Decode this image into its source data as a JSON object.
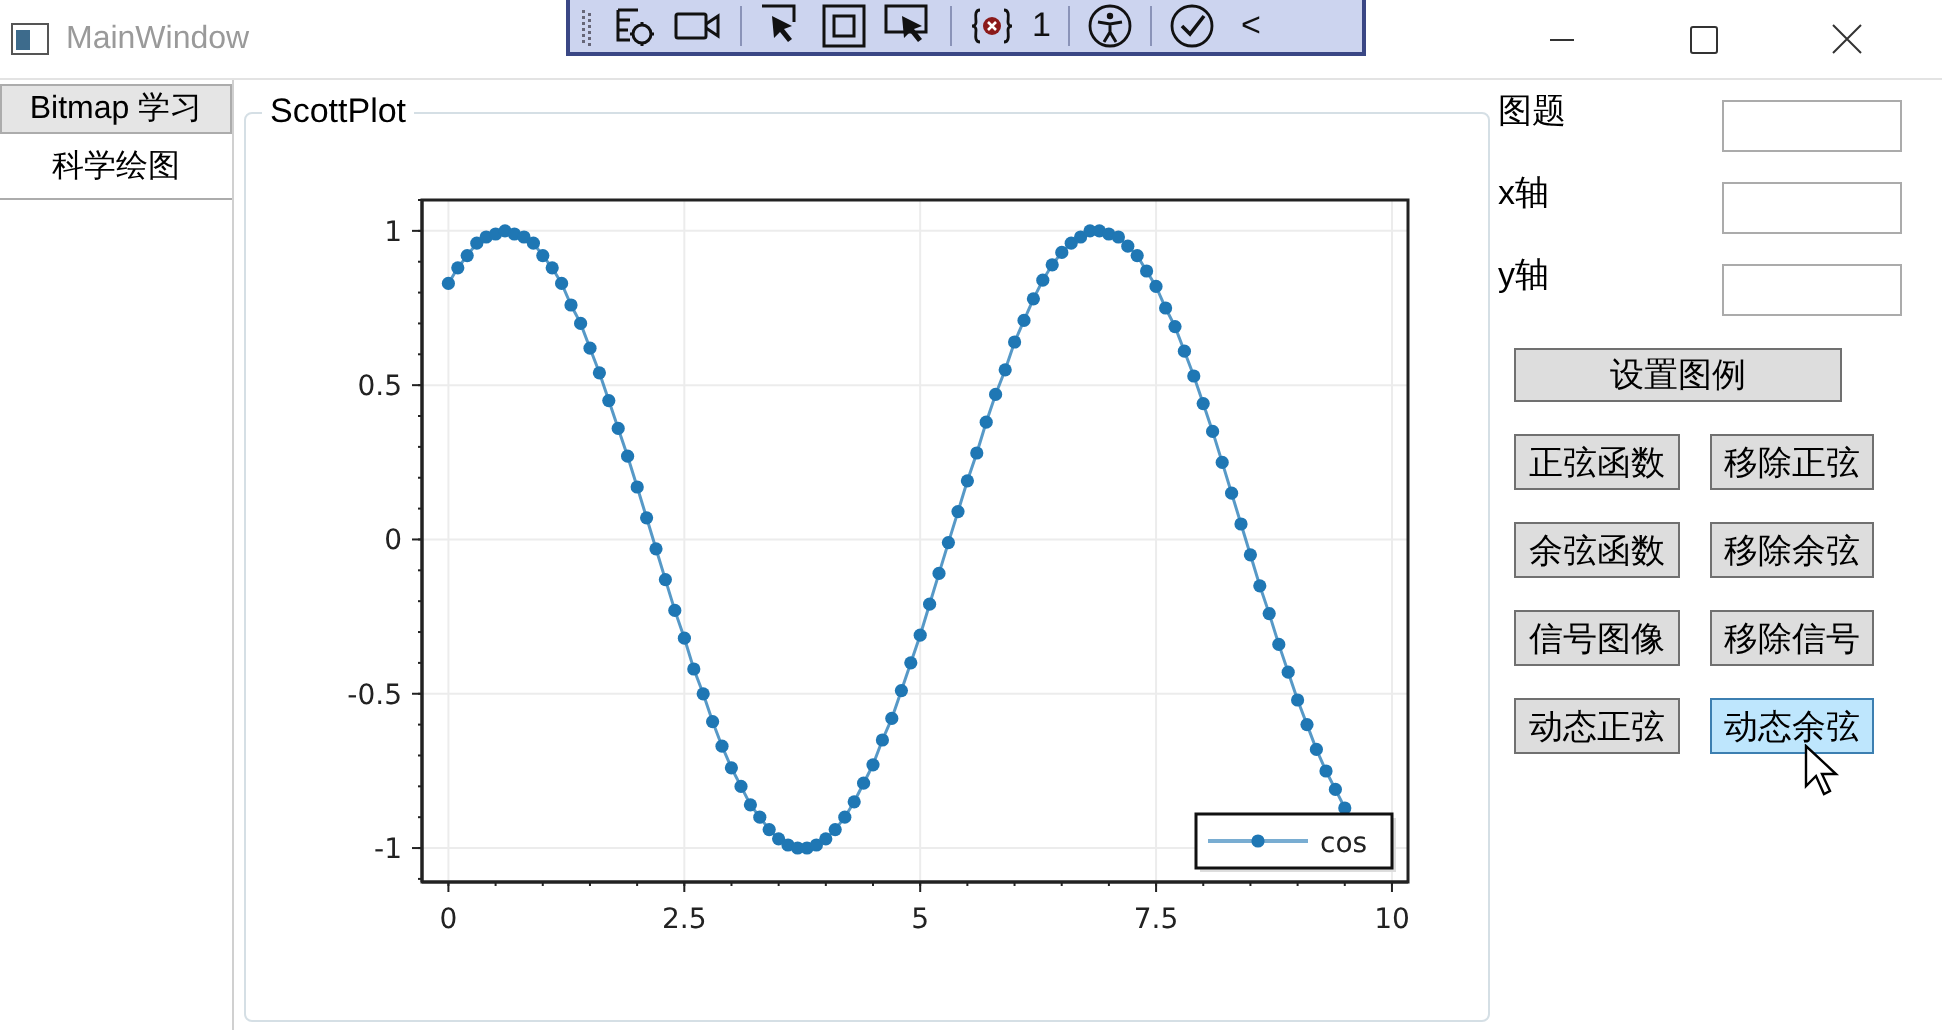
{
  "window": {
    "title": "MainWindow"
  },
  "debug_toolbar": {
    "binding_error_count": "1",
    "collapse": "<"
  },
  "tabs": [
    {
      "label": "Bitmap 学习",
      "selected": false
    },
    {
      "label": "科学绘图",
      "selected": true
    }
  ],
  "plot_group": {
    "title": "ScottPlot",
    "chart_data": {
      "type": "line",
      "grid": true,
      "xlim": [
        -0.28,
        10.17
      ],
      "ylim": [
        -1.11,
        1.1
      ],
      "xticks": [
        0,
        2.5,
        5,
        7.5,
        10
      ],
      "yticks": [
        -1,
        -0.5,
        0,
        0.5,
        1
      ],
      "x": [
        0,
        0.1,
        0.2,
        0.3,
        0.4,
        0.5,
        0.6,
        0.7,
        0.8,
        0.9,
        1,
        1.1,
        1.2,
        1.3,
        1.4,
        1.5,
        1.6,
        1.7,
        1.8,
        1.9,
        2,
        2.1,
        2.2,
        2.3,
        2.4,
        2.5,
        2.6,
        2.7,
        2.8,
        2.9,
        3,
        3.1,
        3.2,
        3.3,
        3.4,
        3.5,
        3.6,
        3.7,
        3.8,
        3.9,
        4,
        4.1,
        4.2,
        4.3,
        4.4,
        4.5,
        4.6,
        4.7,
        4.8,
        4.9,
        5,
        5.1,
        5.2,
        5.3,
        5.4,
        5.5,
        5.6,
        5.7,
        5.8,
        5.9,
        6,
        6.1,
        6.2,
        6.3,
        6.4,
        6.5,
        6.6,
        6.7,
        6.8,
        6.9,
        7,
        7.1,
        7.2,
        7.3,
        7.4,
        7.5,
        7.6,
        7.7,
        7.8,
        7.9,
        8,
        8.1,
        8.2,
        8.3,
        8.4,
        8.5,
        8.6,
        8.7,
        8.8,
        8.9,
        9,
        9.1,
        9.2,
        9.3,
        9.4,
        9.5
      ],
      "series": [
        {
          "name": "cos",
          "color": "#1f77b4",
          "marker": "circle",
          "values": [
            0.83,
            0.88,
            0.92,
            0.96,
            0.98,
            0.99,
            1,
            0.99,
            0.98,
            0.96,
            0.92,
            0.88,
            0.83,
            0.76,
            0.7,
            0.62,
            0.54,
            0.45,
            0.36,
            0.27,
            0.17,
            0.07,
            -0.03,
            -0.13,
            -0.23,
            -0.32,
            -0.42,
            -0.5,
            -0.59,
            -0.67,
            -0.74,
            -0.8,
            -0.86,
            -0.9,
            -0.94,
            -0.97,
            -0.99,
            -1,
            -1,
            -0.99,
            -0.97,
            -0.94,
            -0.9,
            -0.85,
            -0.79,
            -0.73,
            -0.65,
            -0.58,
            -0.49,
            -0.4,
            -0.31,
            -0.21,
            -0.11,
            -0.01,
            0.09,
            0.19,
            0.28,
            0.38,
            0.47,
            0.55,
            0.64,
            0.71,
            0.78,
            0.84,
            0.89,
            0.93,
            0.96,
            0.98,
            1,
            1,
            0.99,
            0.98,
            0.95,
            0.92,
            0.87,
            0.82,
            0.75,
            0.69,
            0.61,
            0.53,
            0.44,
            0.35,
            0.25,
            0.15,
            0.05,
            -0.05,
            -0.15,
            -0.24,
            -0.34,
            -0.43,
            -0.52,
            -0.6,
            -0.68,
            -0.75,
            -0.81,
            -0.87
          ]
        }
      ]
    }
  },
  "fields": [
    {
      "label": "图题"
    },
    {
      "label": "x轴"
    },
    {
      "label": "y轴"
    }
  ],
  "legend_button": {
    "label": "设置图例"
  },
  "buttons": [
    {
      "label": "正弦函数",
      "hovered": false
    },
    {
      "label": "移除正弦",
      "hovered": false
    },
    {
      "label": "余弦函数",
      "hovered": false
    },
    {
      "label": "移除余弦",
      "hovered": false
    },
    {
      "label": "信号图像",
      "hovered": false
    },
    {
      "label": "移除信号",
      "hovered": false
    },
    {
      "label": "动态正弦",
      "hovered": false
    },
    {
      "label": "动态余弦",
      "hovered": true
    }
  ]
}
